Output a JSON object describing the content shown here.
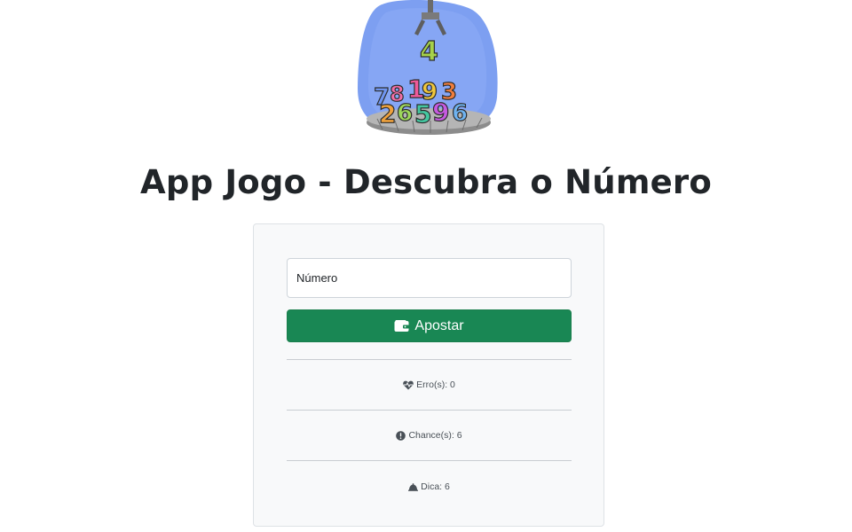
{
  "header": {
    "logo_icon": "claw-machine-numbers-icon",
    "title": "App Jogo - Descubra o Número"
  },
  "game": {
    "input_placeholder": "Número",
    "input_value": "",
    "bet_button_label": "Apostar",
    "bet_button_icon": "wallet-icon",
    "stats": [
      {
        "icon": "heart-pulse-icon",
        "text": "Erro(s): 0"
      },
      {
        "icon": "exclamation-circle-icon",
        "text": "Chance(s): 6"
      },
      {
        "icon": "bell-icon",
        "text": "Dica: 6"
      }
    ]
  },
  "colors": {
    "primary_button": "#198754",
    "card_background": "#f8f9fa",
    "text": "#212529"
  }
}
